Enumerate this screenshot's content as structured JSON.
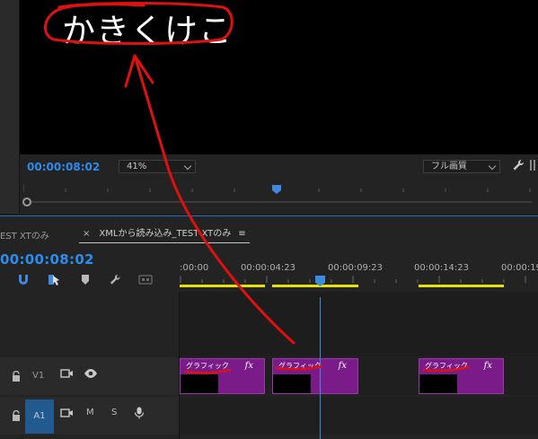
{
  "monitor": {
    "caption": "かきくけこ",
    "timecode": "00:00:08:02",
    "zoom": "41%",
    "resolution": "フル画質"
  },
  "timeline": {
    "prev_tab": "EST  XTのみ",
    "active_tab": "XMLから読み込み_TEST  XTのみ",
    "tab_close": "×",
    "tab_menu": "≡",
    "timecode": "00:00:08:02",
    "ruler_labels": [
      ":00:00",
      "00:00:04:23",
      "00:00:09:23",
      "00:00:14:23",
      "00:00:19"
    ],
    "tracks": {
      "v1": {
        "name": "V1"
      },
      "a1": {
        "name": "A1",
        "mute": "M",
        "solo": "S"
      }
    },
    "clips": [
      {
        "label": "グラフィック",
        "fx": "fx"
      },
      {
        "label": "グラフィック",
        "fx": "fx"
      },
      {
        "label": "グラフィック",
        "fx": "fx"
      }
    ]
  },
  "colors": {
    "accent": "#2d8ceb",
    "clip": "#7b1b8a",
    "annotation": "#e01010",
    "work_area": "#e6e300"
  }
}
